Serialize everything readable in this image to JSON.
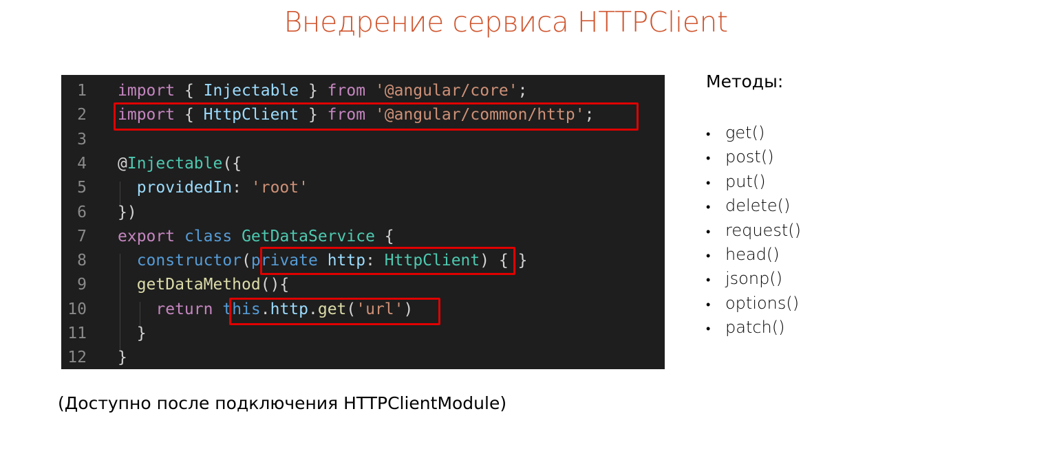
{
  "slide": {
    "title": "Внедрение сервиса HTTPClient",
    "footnote": "(Доступно после подключения HTTPClientModule)"
  },
  "code": {
    "lines": [
      {
        "no": "1",
        "tokens": [
          {
            "t": "import",
            "c": "kw-ctrl"
          },
          {
            "t": " { ",
            "c": "punc"
          },
          {
            "t": "Injectable",
            "c": "var"
          },
          {
            "t": " } ",
            "c": "punc"
          },
          {
            "t": "from",
            "c": "kw-ctrl"
          },
          {
            "t": " ",
            "c": "punc"
          },
          {
            "t": "'@angular/core'",
            "c": "str"
          },
          {
            "t": ";",
            "c": "punc"
          }
        ]
      },
      {
        "no": "2",
        "tokens": [
          {
            "t": "import",
            "c": "kw-ctrl"
          },
          {
            "t": " { ",
            "c": "punc"
          },
          {
            "t": "HttpClient",
            "c": "var"
          },
          {
            "t": " } ",
            "c": "punc"
          },
          {
            "t": "from",
            "c": "kw-ctrl"
          },
          {
            "t": " ",
            "c": "punc"
          },
          {
            "t": "'@angular/common/http'",
            "c": "str"
          },
          {
            "t": ";",
            "c": "punc"
          }
        ]
      },
      {
        "no": "3",
        "tokens": []
      },
      {
        "no": "4",
        "tokens": [
          {
            "t": "@",
            "c": "punc"
          },
          {
            "t": "Injectable",
            "c": "ty"
          },
          {
            "t": "({",
            "c": "punc"
          }
        ]
      },
      {
        "no": "5",
        "tokens": [
          {
            "t": "  ",
            "c": "punc"
          },
          {
            "t": "providedIn",
            "c": "var"
          },
          {
            "t": ": ",
            "c": "punc"
          },
          {
            "t": "'root'",
            "c": "str"
          }
        ]
      },
      {
        "no": "6",
        "tokens": [
          {
            "t": "})",
            "c": "punc"
          }
        ]
      },
      {
        "no": "7",
        "tokens": [
          {
            "t": "export",
            "c": "kw-ctrl"
          },
          {
            "t": " ",
            "c": "punc"
          },
          {
            "t": "class",
            "c": "kw"
          },
          {
            "t": " ",
            "c": "punc"
          },
          {
            "t": "GetDataService",
            "c": "ty"
          },
          {
            "t": " {",
            "c": "punc"
          }
        ]
      },
      {
        "no": "8",
        "tokens": [
          {
            "t": "  ",
            "c": "punc"
          },
          {
            "t": "constructor",
            "c": "kw"
          },
          {
            "t": "(",
            "c": "punc"
          },
          {
            "t": "private",
            "c": "kw"
          },
          {
            "t": " ",
            "c": "punc"
          },
          {
            "t": "http",
            "c": "var"
          },
          {
            "t": ": ",
            "c": "punc"
          },
          {
            "t": "HttpClient",
            "c": "ty"
          },
          {
            "t": ") { }",
            "c": "punc"
          }
        ]
      },
      {
        "no": "9",
        "tokens": [
          {
            "t": "  ",
            "c": "punc"
          },
          {
            "t": "getDataMethod",
            "c": "fn"
          },
          {
            "t": "(){",
            "c": "punc"
          }
        ]
      },
      {
        "no": "10",
        "tokens": [
          {
            "t": "    ",
            "c": "punc"
          },
          {
            "t": "return",
            "c": "kw-ctrl"
          },
          {
            "t": " ",
            "c": "punc"
          },
          {
            "t": "this",
            "c": "kw"
          },
          {
            "t": ".",
            "c": "punc"
          },
          {
            "t": "http",
            "c": "var"
          },
          {
            "t": ".",
            "c": "punc"
          },
          {
            "t": "get",
            "c": "fn"
          },
          {
            "t": "(",
            "c": "punc"
          },
          {
            "t": "'url'",
            "c": "str"
          },
          {
            "t": ")",
            "c": "punc"
          }
        ]
      },
      {
        "no": "11",
        "tokens": [
          {
            "t": "  }",
            "c": "punc"
          }
        ]
      },
      {
        "no": "12",
        "tokens": [
          {
            "t": "}",
            "c": "punc"
          }
        ]
      }
    ]
  },
  "methods": {
    "heading": "Методы:",
    "bullet": "•",
    "items": [
      "get()",
      "post()",
      "put()",
      "delete()",
      "request()",
      "head()",
      "jsonp()",
      "options()",
      "patch()"
    ]
  },
  "colors": {
    "title": "#d0562f",
    "editor_bg": "#1e1e1e",
    "highlight_border": "#e00000"
  }
}
